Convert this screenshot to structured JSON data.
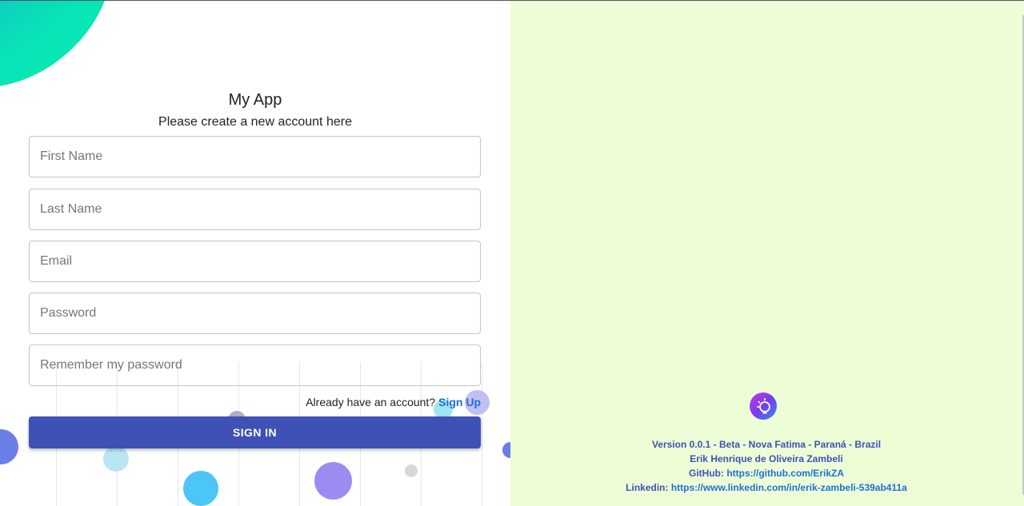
{
  "app": {
    "title": "My App",
    "subtitle": "Please create a new account here"
  },
  "form": {
    "first_name_placeholder": "First Name",
    "last_name_placeholder": "Last Name",
    "email_placeholder": "Email",
    "password_placeholder": "Password",
    "remember_placeholder": "Remember my password",
    "already_text": "Already have an account?",
    "signup_link": "Sign Up",
    "signin_button": "SIGN IN"
  },
  "footer": {
    "version": "Version 0.0.1 - Beta - Nova Fatima - Paraná - Brazil",
    "author": "Erik Henrique de Oliveira Zambeli",
    "github_label": "GitHub:",
    "github_url": "https://github.com/ErikZA",
    "linkedin_label": "Linkedin:",
    "linkedin_url": "https://www.linkedin.com/in/erik-zambeli-539ab411a"
  },
  "colors": {
    "primary": "#3f51b5",
    "right_panel_bg": "#edfdd6",
    "link": "#1e6fd9"
  },
  "icons": {
    "logo": "lightbulb-icon"
  }
}
